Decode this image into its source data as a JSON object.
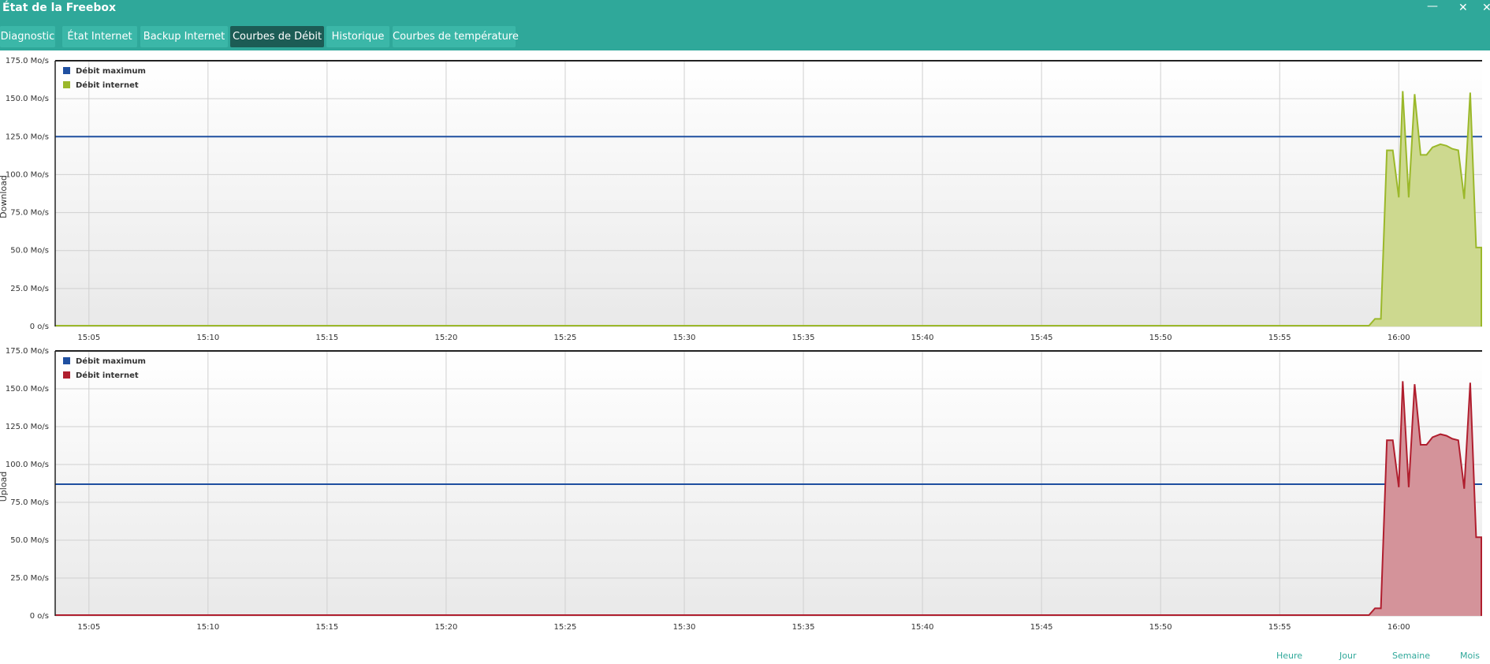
{
  "window": {
    "title": "État de la Freebox",
    "minimize": "—",
    "restore": "✕",
    "close": "✕"
  },
  "tabs": [
    {
      "label": "Diagnostic",
      "active": false
    },
    {
      "label": "État Internet",
      "active": false
    },
    {
      "label": "Backup Internet",
      "active": false
    },
    {
      "label": "Courbes de Débit",
      "active": true
    },
    {
      "label": "Historique",
      "active": false
    },
    {
      "label": "Courbes de température",
      "active": false
    }
  ],
  "time_range": [
    "Heure",
    "Jour",
    "Semaine",
    "Mois"
  ],
  "colors": {
    "accent": "#2fa89a",
    "tab_active": "#1c5c55",
    "max_line": "#1f4fa0",
    "download": "#9bb82a",
    "upload": "#b01e2e"
  },
  "chart_data": [
    {
      "type": "area",
      "ylabel": "Download",
      "unit": "Mo/s",
      "ylim": [
        0,
        175
      ],
      "y_ticks": [
        "0 o/s",
        "25.0 Mo/s",
        "50.0 Mo/s",
        "75.0 Mo/s",
        "100.0 Mo/s",
        "125.0 Mo/s",
        "150.0 Mo/s",
        "175.0 Mo/s"
      ],
      "x_ticks": [
        "15:05",
        "15:10",
        "15:15",
        "15:20",
        "15:25",
        "15:30",
        "15:35",
        "15:40",
        "15:45",
        "15:50",
        "15:55",
        "16:00"
      ],
      "xlim": [
        "15:03:35",
        "16:03:30"
      ],
      "grid": true,
      "legend_position": "top-left",
      "series": [
        {
          "name": "Débit maximum",
          "kind": "line",
          "color": "#1f4fa0",
          "value": 125
        },
        {
          "name": "Débit internet",
          "kind": "area",
          "color": "#9bb82a",
          "fill": "#cdd98f",
          "points": [
            [
              "15:03:35",
              0.5
            ],
            [
              "15:58:45",
              0.5
            ],
            [
              "15:59:00",
              5
            ],
            [
              "15:59:15",
              5
            ],
            [
              "15:59:30",
              116
            ],
            [
              "15:59:45",
              116
            ],
            [
              "16:00:00",
              85
            ],
            [
              "16:00:10",
              155
            ],
            [
              "16:00:25",
              85
            ],
            [
              "16:00:40",
              153
            ],
            [
              "16:00:55",
              113
            ],
            [
              "16:01:10",
              113
            ],
            [
              "16:01:25",
              118
            ],
            [
              "16:01:45",
              120
            ],
            [
              "16:02:00",
              119
            ],
            [
              "16:02:15",
              117
            ],
            [
              "16:02:30",
              116
            ],
            [
              "16:02:45",
              84
            ],
            [
              "16:03:00",
              154
            ],
            [
              "16:03:15",
              52
            ],
            [
              "16:03:30",
              52
            ],
            [
              "16:03:40",
              2
            ],
            [
              "16:04:00",
              2
            ],
            [
              "16:04:00",
              0
            ]
          ]
        }
      ]
    },
    {
      "type": "area",
      "ylabel": "Upload",
      "unit": "Mo/s",
      "ylim": [
        0,
        175
      ],
      "y_ticks": [
        "0 o/s",
        "25.0 Mo/s",
        "50.0 Mo/s",
        "75.0 Mo/s",
        "100.0 Mo/s",
        "125.0 Mo/s",
        "150.0 Mo/s",
        "175.0 Mo/s"
      ],
      "x_ticks": [
        "15:05",
        "15:10",
        "15:15",
        "15:20",
        "15:25",
        "15:30",
        "15:35",
        "15:40",
        "15:45",
        "15:50",
        "15:55",
        "16:00"
      ],
      "xlim": [
        "15:03:35",
        "16:03:30"
      ],
      "grid": true,
      "legend_position": "top-left",
      "series": [
        {
          "name": "Débit maximum",
          "kind": "line",
          "color": "#1f4fa0",
          "value": 87
        },
        {
          "name": "Débit internet",
          "kind": "area",
          "color": "#b01e2e",
          "fill": "#d4939a",
          "points": [
            [
              "15:03:35",
              0.5
            ],
            [
              "15:58:45",
              0.5
            ],
            [
              "15:59:00",
              5
            ],
            [
              "15:59:15",
              5
            ],
            [
              "15:59:30",
              116
            ],
            [
              "15:59:45",
              116
            ],
            [
              "16:00:00",
              85
            ],
            [
              "16:00:10",
              155
            ],
            [
              "16:00:25",
              85
            ],
            [
              "16:00:40",
              153
            ],
            [
              "16:00:55",
              113
            ],
            [
              "16:01:10",
              113
            ],
            [
              "16:01:25",
              118
            ],
            [
              "16:01:45",
              120
            ],
            [
              "16:02:00",
              119
            ],
            [
              "16:02:15",
              117
            ],
            [
              "16:02:30",
              116
            ],
            [
              "16:02:45",
              84
            ],
            [
              "16:03:00",
              154
            ],
            [
              "16:03:15",
              52
            ],
            [
              "16:03:30",
              52
            ],
            [
              "16:03:40",
              2
            ],
            [
              "16:04:00",
              2
            ],
            [
              "16:04:00",
              0
            ]
          ]
        }
      ]
    }
  ]
}
